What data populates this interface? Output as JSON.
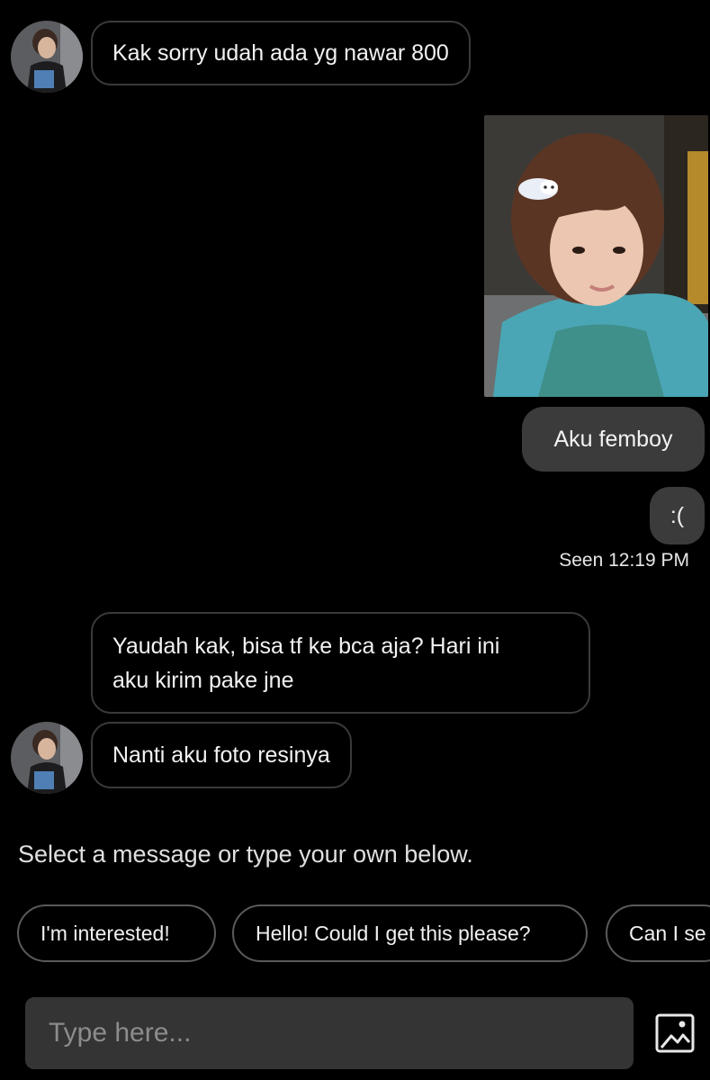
{
  "messages": {
    "m1": "Kak sorry udah ada yg nawar 800",
    "m2": "Aku femboy",
    "m3": ":(",
    "seen": "Seen 12:19 PM",
    "m4_line1": "Yaudah kak, bisa tf ke bca aja? Hari ini",
    "m4_line2": "aku kirim pake jne",
    "m5": "Nanti aku foto resinya"
  },
  "quick_replies": {
    "prompt": "Select a message or type your own below.",
    "chips": [
      "I'm interested!",
      "Hello! Could I get this please?",
      "Can I se"
    ]
  },
  "composer": {
    "placeholder": "Type here...",
    "image_icon": "image-upload-icon"
  },
  "colors": {
    "background": "#000000",
    "outgoing_bubble": "#3b3b3b",
    "incoming_border": "#3a3a3a",
    "input_bg": "#343434"
  }
}
